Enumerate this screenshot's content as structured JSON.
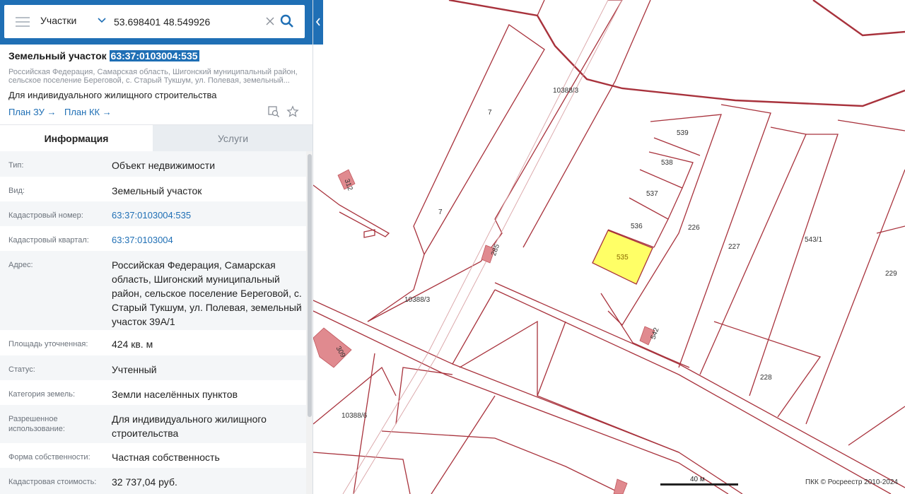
{
  "search": {
    "layer": "Участки",
    "query": "53.698401 48.549926"
  },
  "object": {
    "title_prefix": "Земельный участок",
    "cadastral_number": "63:37:0103004:535",
    "address_short": "Российская Федерация, Самарская область, Шигонский муниципальный район, сельское поселение Береговой, с. Старый Тукшум, ул. Полевая, земельный...",
    "use": "Для индивидуального жилищного строительства",
    "plan_zu": "План ЗУ",
    "plan_kk": "План КК"
  },
  "tabs": {
    "info": "Информация",
    "services": "Услуги"
  },
  "info_rows": [
    {
      "key": "Тип:",
      "value": "Объект недвижимости"
    },
    {
      "key": "Вид:",
      "value": "Земельный участок"
    },
    {
      "key": "Кадастровый номер:",
      "value": "63:37:0103004:535"
    },
    {
      "key": "Кадастровый квартал:",
      "value": "63:37:0103004"
    },
    {
      "key": "Адрес:",
      "value": "Российская Федерация, Самарская область, Шигонский муниципальный район, сельское поселение Береговой, с. Старый Тукшум, ул. Полевая, земельный участок 39А/1"
    },
    {
      "key": "Площадь уточненная:",
      "value": "424 кв. м"
    },
    {
      "key": "Статус:",
      "value": "Учтенный"
    },
    {
      "key": "Категория земель:",
      "value": "Земли населённых пунктов"
    },
    {
      "key": "Разрешенное использование:",
      "value": "Для индивидуального жилищного строительства"
    },
    {
      "key": "Форма собственности:",
      "value": "Частная собственность"
    },
    {
      "key": "Кадастровая стоимость:",
      "value": "32 737,04 руб."
    }
  ],
  "map": {
    "labels": [
      "539",
      "538",
      "537",
      "536",
      "535",
      "226",
      "227",
      "543/1",
      "229",
      "228",
      "542",
      "285",
      "10388/3",
      "10388/3",
      "10388/6",
      "7",
      "7",
      "312",
      "309"
    ],
    "scale": "40 м",
    "copyright": "ПКК © Росреестр 2010-2024"
  },
  "colors": {
    "accent": "#1f6fb5",
    "parcel_line": "#a8323c",
    "building_fill": "#e08a8f",
    "selected_fill": "#ffff66"
  }
}
